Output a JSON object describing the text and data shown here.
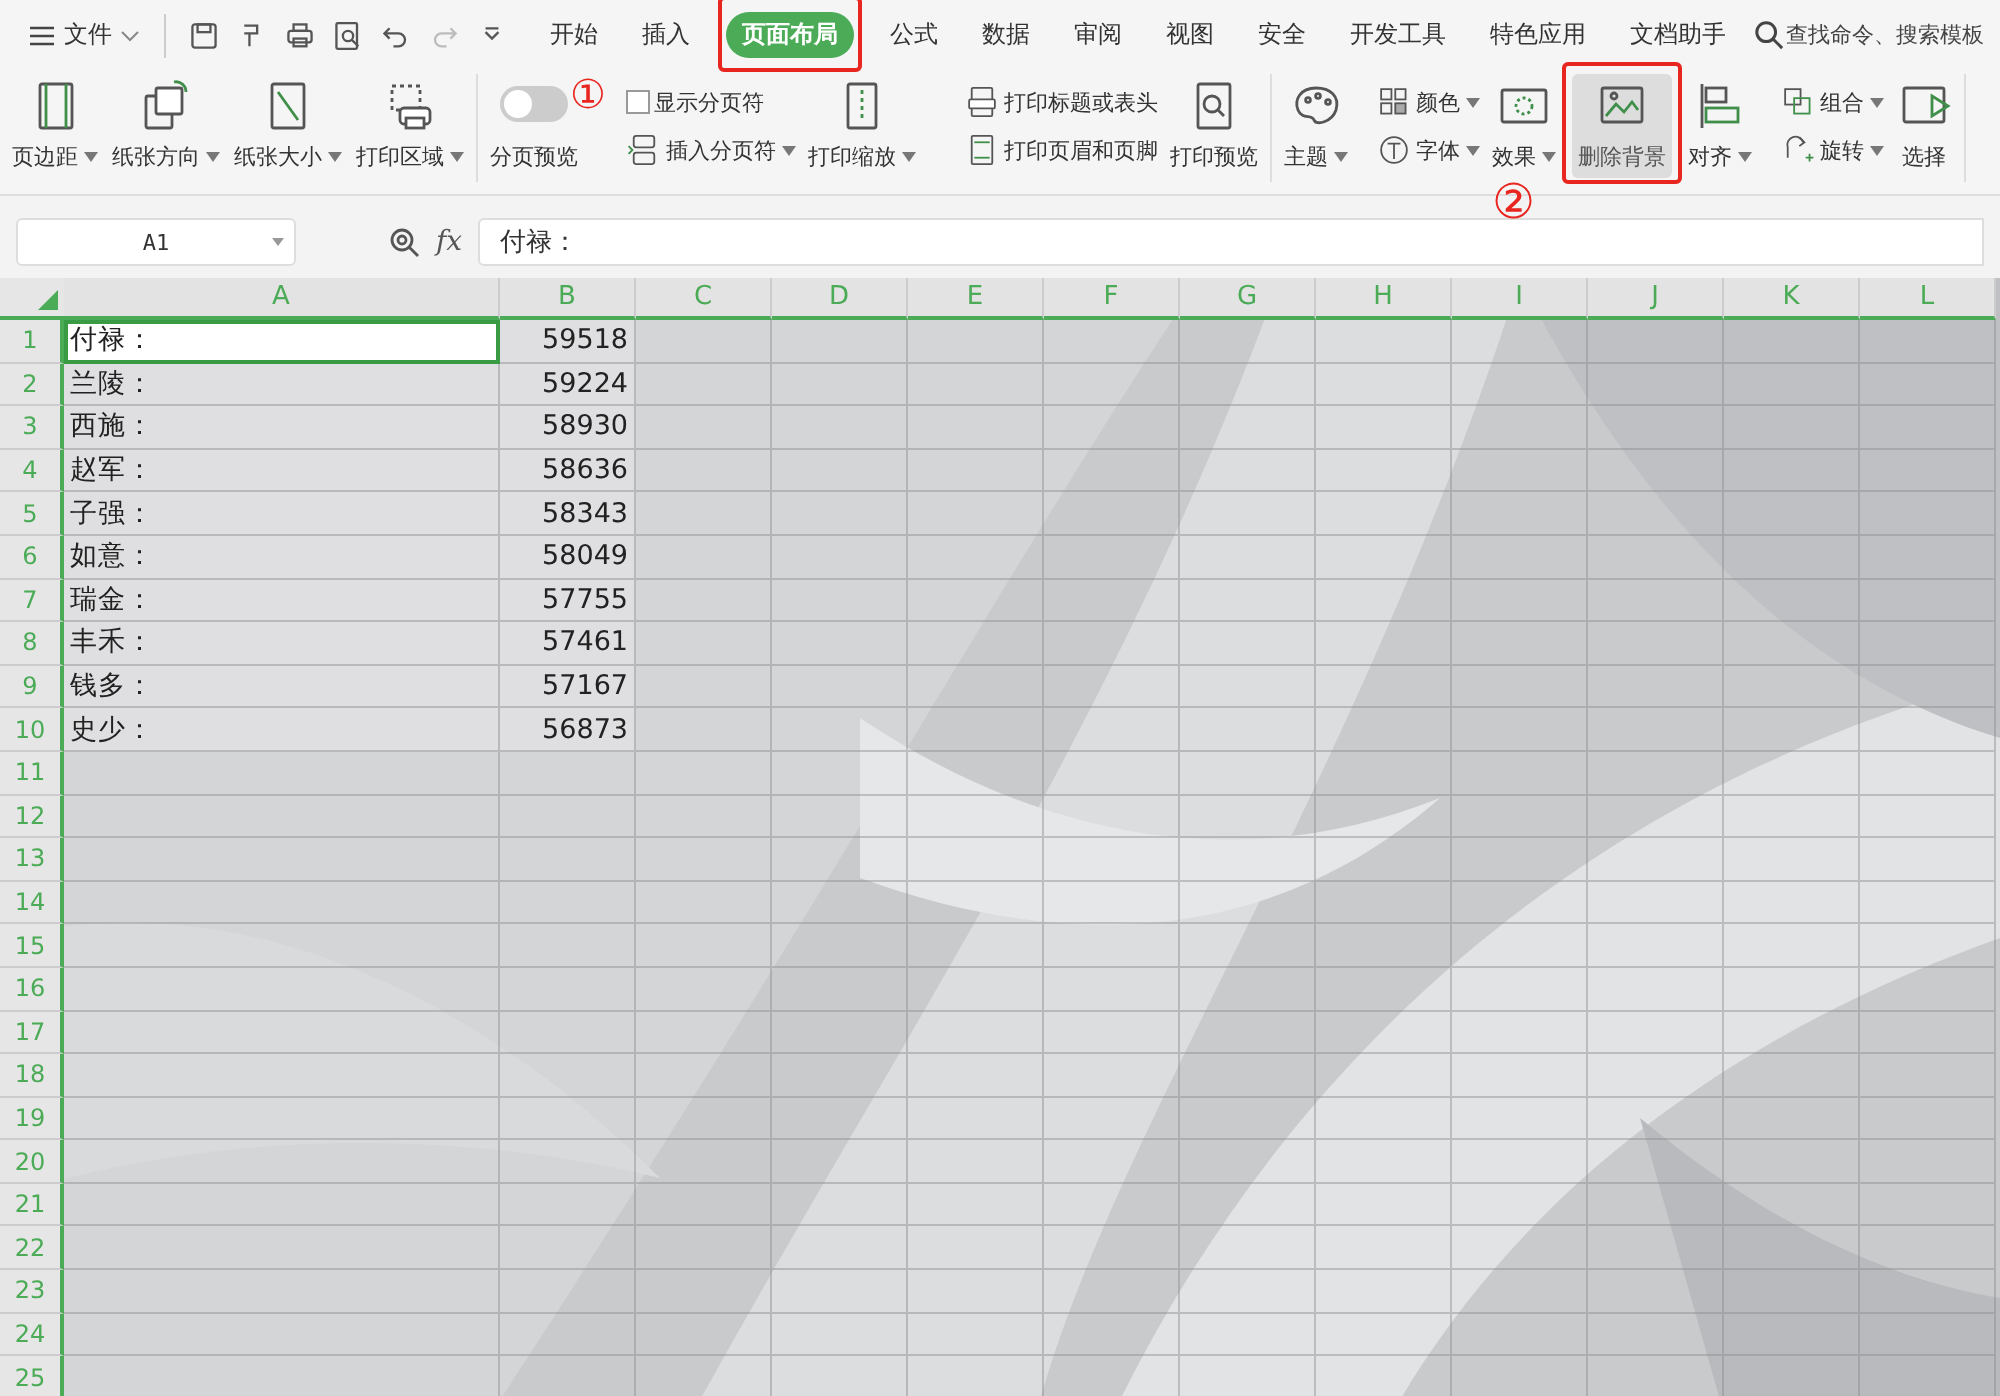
{
  "menu": {
    "label": "文件"
  },
  "quick_tools": [
    {
      "disabled": false
    },
    {
      "disabled": false
    },
    {
      "disabled": false
    },
    {
      "disabled": false
    },
    {
      "disabled": false
    },
    {
      "disabled": true
    },
    {
      "disabled": false
    }
  ],
  "tabs": [
    {
      "label": "开始",
      "selected": false
    },
    {
      "label": "插入",
      "selected": false
    },
    {
      "label": "页面布局",
      "selected": true
    },
    {
      "label": "公式",
      "selected": false
    },
    {
      "label": "数据",
      "selected": false
    },
    {
      "label": "审阅",
      "selected": false
    },
    {
      "label": "视图",
      "selected": false
    },
    {
      "label": "安全",
      "selected": false
    },
    {
      "label": "开发工具",
      "selected": false
    },
    {
      "label": "特色应用",
      "selected": false
    },
    {
      "label": "文档助手",
      "selected": false
    }
  ],
  "search": {
    "placeholder": "查找命令、搜索模板"
  },
  "ribbon": {
    "groups": [
      {
        "items": [
          {
            "kind": "big",
            "label": "页边距",
            "dropdown": true,
            "highlighted": false
          },
          {
            "kind": "big",
            "label": "纸张方向",
            "dropdown": true,
            "highlighted": false
          },
          {
            "kind": "big",
            "label": "纸张大小",
            "dropdown": true,
            "highlighted": false
          },
          {
            "kind": "big",
            "label": "打印区域",
            "dropdown": true,
            "highlighted": false
          }
        ]
      },
      {
        "items": [
          {
            "kind": "toggle",
            "label": "分页预览",
            "on": false
          },
          {
            "kind": "stack",
            "rows": [
              {
                "kind": "checkbox",
                "label": "显示分页符",
                "checked": false,
                "dropdown": false
              },
              {
                "kind": "plain",
                "label": "插入分页符",
                "dropdown": true
              }
            ]
          },
          {
            "kind": "big",
            "label": "打印缩放",
            "dropdown": true,
            "highlighted": false
          },
          {
            "kind": "stack",
            "rows": [
              {
                "kind": "plain",
                "label": "打印标题或表头",
                "dropdown": false
              },
              {
                "kind": "plain",
                "label": "打印页眉和页脚",
                "dropdown": false
              }
            ]
          },
          {
            "kind": "big",
            "label": "打印预览",
            "dropdown": false,
            "highlighted": false
          }
        ]
      },
      {
        "items": [
          {
            "kind": "big",
            "label": "主题",
            "dropdown": true,
            "highlighted": false
          },
          {
            "kind": "stack",
            "rows": [
              {
                "kind": "plain",
                "label": "颜色",
                "dropdown": true
              },
              {
                "kind": "plain",
                "label": "字体",
                "dropdown": true
              }
            ]
          },
          {
            "kind": "big",
            "label": "效果",
            "dropdown": true,
            "highlighted": false
          },
          {
            "kind": "big",
            "label": "删除背景",
            "dropdown": false,
            "highlighted": true
          },
          {
            "kind": "big",
            "label": "对齐",
            "dropdown": true,
            "highlighted": false
          },
          {
            "kind": "stack",
            "rows": [
              {
                "kind": "plain",
                "label": "组合",
                "dropdown": true
              },
              {
                "kind": "plain",
                "label": "旋转",
                "dropdown": true
              }
            ]
          },
          {
            "kind": "big",
            "label": "选择",
            "dropdown": false,
            "highlighted": false
          }
        ]
      }
    ]
  },
  "formula_bar": {
    "name_box": "A1",
    "fx": "fx",
    "value": "付禄："
  },
  "sheet": {
    "columns": [
      "A",
      "B",
      "C",
      "D",
      "E",
      "F",
      "G",
      "H",
      "I",
      "J",
      "K",
      "L"
    ],
    "rows": [
      {
        "number": "1",
        "cells": [
          {
            "text": "付禄：",
            "selected": true
          },
          {
            "text": "59518",
            "selected": false
          }
        ]
      },
      {
        "number": "2",
        "cells": [
          {
            "text": "兰陵：",
            "selected": false
          },
          {
            "text": "59224",
            "selected": false
          }
        ]
      },
      {
        "number": "3",
        "cells": [
          {
            "text": "西施：",
            "selected": false
          },
          {
            "text": "58930",
            "selected": false
          }
        ]
      },
      {
        "number": "4",
        "cells": [
          {
            "text": "赵军：",
            "selected": false
          },
          {
            "text": "58636",
            "selected": false
          }
        ]
      },
      {
        "number": "5",
        "cells": [
          {
            "text": "子强：",
            "selected": false
          },
          {
            "text": "58343",
            "selected": false
          }
        ]
      },
      {
        "number": "6",
        "cells": [
          {
            "text": "如意：",
            "selected": false
          },
          {
            "text": "58049",
            "selected": false
          }
        ]
      },
      {
        "number": "7",
        "cells": [
          {
            "text": "瑞金：",
            "selected": false
          },
          {
            "text": "57755",
            "selected": false
          }
        ]
      },
      {
        "number": "8",
        "cells": [
          {
            "text": "丰禾：",
            "selected": false
          },
          {
            "text": "57461",
            "selected": false
          }
        ]
      },
      {
        "number": "9",
        "cells": [
          {
            "text": "钱多：",
            "selected": false
          },
          {
            "text": "57167",
            "selected": false
          }
        ]
      },
      {
        "number": "10",
        "cells": [
          {
            "text": "史少：",
            "selected": false
          },
          {
            "text": "56873",
            "selected": false
          }
        ]
      },
      {
        "number": "11"
      },
      {
        "number": "12"
      },
      {
        "number": "13"
      },
      {
        "number": "14"
      },
      {
        "number": "15"
      },
      {
        "number": "16"
      },
      {
        "number": "17"
      },
      {
        "number": "18"
      },
      {
        "number": "19"
      },
      {
        "number": "20"
      },
      {
        "number": "21"
      },
      {
        "number": "22"
      },
      {
        "number": "23"
      },
      {
        "number": "24"
      },
      {
        "number": "25"
      }
    ]
  },
  "annotations": [
    {
      "label": "①"
    },
    {
      "label": "②"
    }
  ]
}
